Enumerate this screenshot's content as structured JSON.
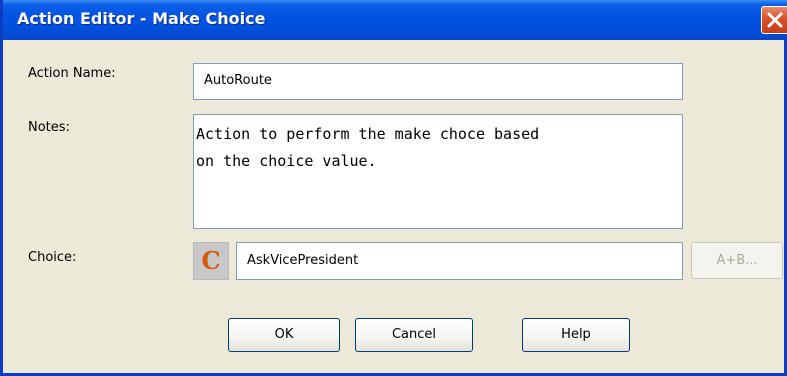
{
  "window": {
    "title": "Action Editor - Make Choice",
    "close_symbol": "×"
  },
  "form": {
    "action_name_label": "Action Name:",
    "action_name_value": "AutoRoute",
    "notes_label": "Notes:",
    "notes_value": "Action to perform the make choce based\non the choice value.",
    "choice_label": "Choice:",
    "choice_icon_letter": "C",
    "choice_value": "AskVicePresident",
    "expression_button_label": "A+B..."
  },
  "buttons": {
    "ok_label": "OK",
    "cancel_label": "Cancel",
    "help_label": "Help"
  },
  "colors": {
    "titlebar": "#0454e4",
    "close_button": "#c83c18",
    "dialog_background": "#ece9d8",
    "choice_icon_letter": "#d35a0c"
  },
  "icons": {
    "close": "close-icon",
    "choice": "choice-icon"
  }
}
